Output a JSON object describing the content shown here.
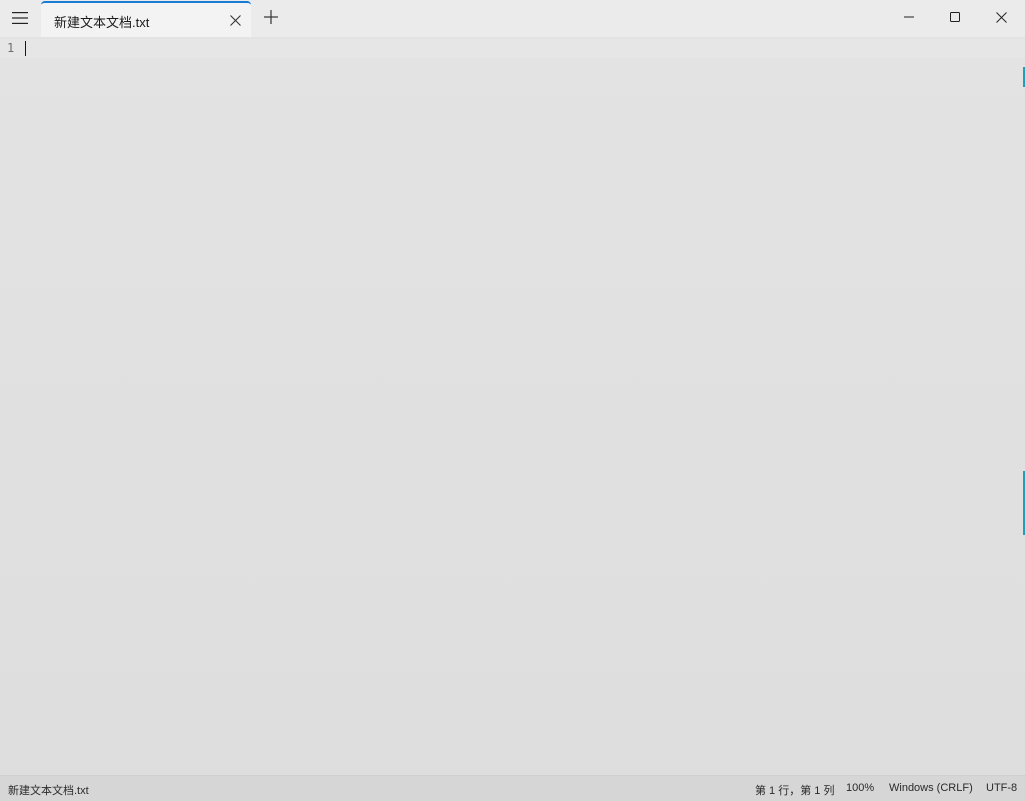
{
  "titlebar": {
    "tab_label": "新建文本文档.txt",
    "menu_icon": "hamburger-menu-icon",
    "tab_close_icon": "close-icon",
    "new_tab_icon": "plus-icon",
    "window_controls": {
      "minimize_icon": "minimize-icon",
      "maximize_icon": "maximize-icon",
      "close_icon": "close-icon"
    },
    "accent_color": "#1a7bd4"
  },
  "editor": {
    "line_numbers": [
      "1"
    ],
    "content": ""
  },
  "statusbar": {
    "file_name": "新建文本文档.txt",
    "cursor_position": "第 1 行，第 1 列",
    "zoom": "100%",
    "line_ending": "Windows (CRLF)",
    "encoding": "UTF-8"
  }
}
